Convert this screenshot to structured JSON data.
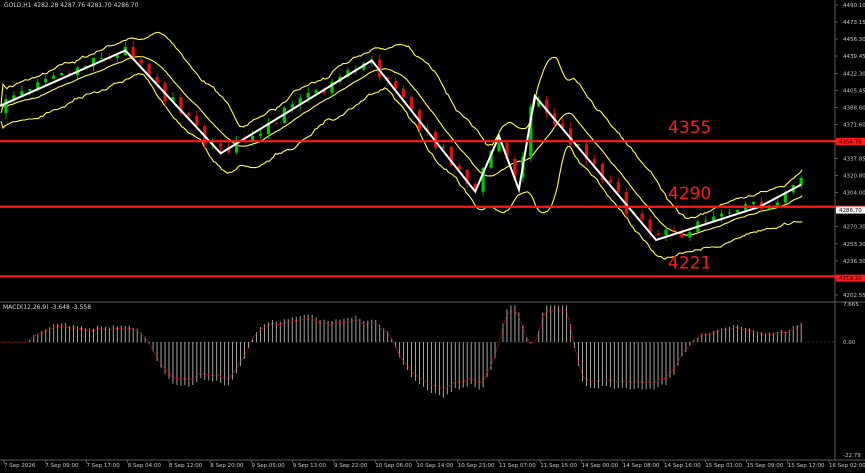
{
  "header": {
    "symbol_line": "GOLD,H1  4282.28 4287.76 4281.70 4286.70",
    "indicator_line": "MACD(12,26,9) -3.648 -3.558"
  },
  "colors": {
    "background": "#000000",
    "bull_candle": "#00c800",
    "bear_candle": "#e01010",
    "bollinger": "#ffff40",
    "zigzag": "#ffffff",
    "level": "#ff1a1a",
    "macd_hist": "#b4b4b4",
    "signal": "#e01010",
    "axis_text": "#c8c8c8"
  },
  "chart_data": [
    {
      "type": "candlestick",
      "symbol": "GOLD",
      "timeframe": "H1",
      "ohlc": {
        "open": 4282.28,
        "high": 4287.76,
        "low": 4281.7,
        "close": 4286.7
      },
      "ylim": [
        4197.55,
        4495.0
      ],
      "y_ticks": [
        4490.1,
        4473.15,
        4456.3,
        4439.45,
        4422.3,
        4405.45,
        4388.6,
        4371.6,
        4354.7,
        4337.85,
        4320.8,
        4304.0,
        4286.7,
        4270.3,
        4253.3,
        4236.3,
        4219.2,
        4202.55
      ],
      "x_ticks": [
        "7 Sep 2026",
        "7 Sep 09:00",
        "7 Sep 17:00",
        "8 Sep 04:00",
        "8 Sep 12:00",
        "8 Sep 20:00",
        "9 Sep 05:00",
        "9 Sep 13:00",
        "9 Sep 22:00",
        "10 Sep 06:00",
        "10 Sep 14:00",
        "10 Sep 23:00",
        "11 Sep 07:00",
        "11 Sep 15:00",
        "14 Sep 00:00",
        "14 Sep 08:00",
        "14 Sep 16:00",
        "15 Sep 01:00",
        "15 Sep 09:00",
        "15 Sep 17:00",
        "16 Sep 02:00"
      ],
      "current_price": 4286.7,
      "price_labels": [
        4354.7,
        4286.7,
        4219.2
      ],
      "levels": [
        {
          "label": "4355",
          "value": 4355
        },
        {
          "label": "4290",
          "value": 4290
        },
        {
          "label": "4221",
          "value": 4221
        }
      ],
      "zigzag": [
        {
          "t": 0,
          "price": 4390
        },
        {
          "t": 63,
          "price": 4445
        },
        {
          "t": 111,
          "price": 4343
        },
        {
          "t": 187,
          "price": 4435
        },
        {
          "t": 239,
          "price": 4305
        },
        {
          "t": 251,
          "price": 4360
        },
        {
          "t": 261,
          "price": 4307
        },
        {
          "t": 269,
          "price": 4400
        },
        {
          "t": 330,
          "price": 4257
        },
        {
          "t": 382,
          "price": 4290
        },
        {
          "t": 403,
          "price": 4312
        }
      ],
      "candles_count": 420,
      "xlabel": "",
      "ylabel": ""
    },
    {
      "type": "histogram",
      "indicator": "MACD(12,26,9)",
      "values_header": [
        -3.648,
        -3.558
      ],
      "ylim": [
        -22.75,
        7.665
      ],
      "y_ticks": [
        7.665,
        0.0,
        -22.79
      ],
      "y_tick_labels": [
        "7.665",
        "0.00",
        "-22.79"
      ]
    }
  ]
}
